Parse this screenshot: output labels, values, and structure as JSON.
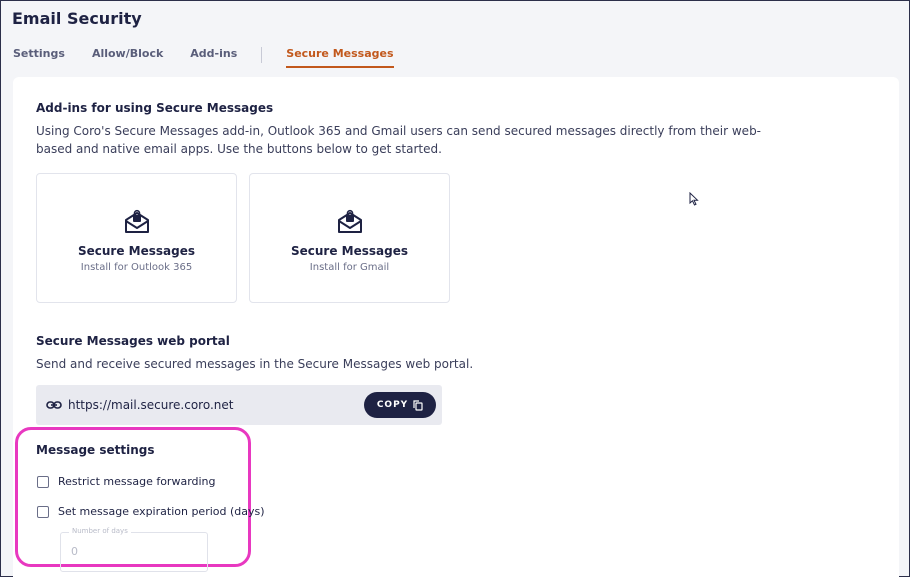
{
  "header": {
    "title": "Email Security"
  },
  "tabs": [
    {
      "label": "Settings"
    },
    {
      "label": "Allow/Block"
    },
    {
      "label": "Add-ins"
    },
    {
      "label": "Secure Messages"
    }
  ],
  "active_tab": "Secure Messages",
  "addins": {
    "title": "Add-ins for using Secure Messages",
    "description": "Using Coro's Secure Messages add-in, Outlook 365 and Gmail users can send secured messages directly from their web-based and native email apps. Use the buttons below to get started.",
    "tiles": [
      {
        "title": "Secure Messages",
        "subtitle": "Install for Outlook 365",
        "icon": "secure-mail-icon"
      },
      {
        "title": "Secure Messages",
        "subtitle": "Install for Gmail",
        "icon": "secure-mail-icon"
      }
    ]
  },
  "portal": {
    "title": "Secure Messages web portal",
    "description": "Send and receive secured messages in the Secure Messages web portal.",
    "url": "https://mail.secure.coro.net",
    "copy_label": "COPY"
  },
  "message_settings": {
    "title": "Message settings",
    "options": [
      {
        "label": "Restrict message forwarding",
        "checked": false
      },
      {
        "label": "Set message expiration period (days)",
        "checked": false
      }
    ],
    "days_field": {
      "label": "Number of days",
      "value": "0"
    }
  },
  "colors": {
    "primary": "#1e2243",
    "accent": "#c2581c",
    "highlight": "#e838c0",
    "background": "#f4f5f8"
  }
}
